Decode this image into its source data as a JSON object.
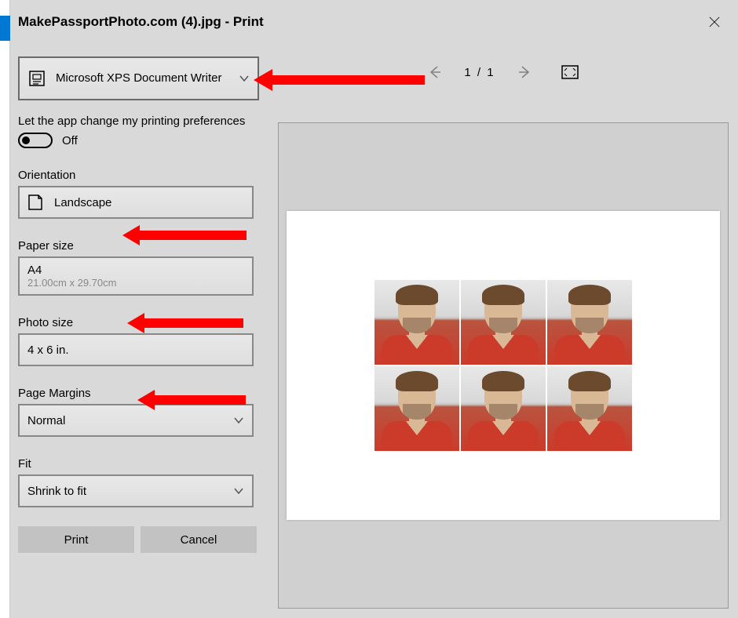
{
  "title": "MakePassportPhoto.com (4).jpg - Print",
  "printer": {
    "name": "Microsoft XPS Document Writer"
  },
  "preferences": {
    "label": "Let the app change my printing preferences",
    "state": "Off"
  },
  "orientation": {
    "label": "Orientation",
    "value": "Landscape"
  },
  "paperSize": {
    "label": "Paper size",
    "value": "A4",
    "dimensions": "21.00cm x 29.70cm"
  },
  "photoSize": {
    "label": "Photo size",
    "value": "4 x 6 in."
  },
  "pageMargins": {
    "label": "Page Margins",
    "value": "Normal"
  },
  "fit": {
    "label": "Fit",
    "value": "Shrink to fit"
  },
  "buttons": {
    "print": "Print",
    "cancel": "Cancel"
  },
  "nav": {
    "page": "1  /  1"
  }
}
